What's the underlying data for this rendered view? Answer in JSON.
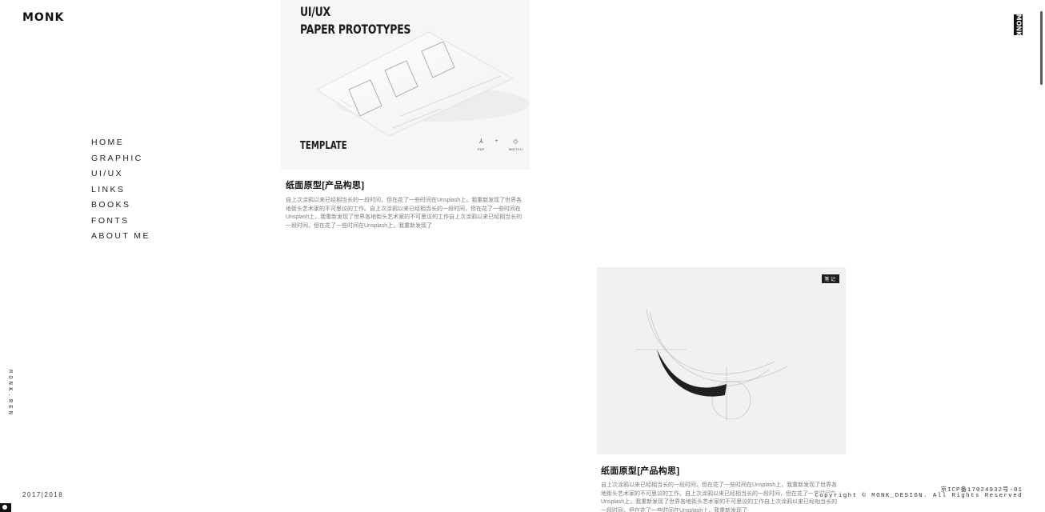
{
  "logo": "MONK",
  "logo_vertical": "MONK",
  "nav": {
    "items": [
      {
        "label": "HOME"
      },
      {
        "label": "GRAPHIC"
      },
      {
        "label": "UI/UX"
      },
      {
        "label": "LINKS"
      },
      {
        "label": "BOOKS"
      },
      {
        "label": "FONTS"
      },
      {
        "label": "ABOUT ME"
      }
    ]
  },
  "site_name": "MONK.REN",
  "years": "2017|2018",
  "cards": [
    {
      "image": {
        "title_line1": "UI/UX",
        "title_line2": "PAPER PROTOTYPES",
        "label": "TEMPLATE",
        "formats": [
          {
            "icon": "pdf-icon",
            "glyph": "⅄",
            "label": "PDF"
          },
          {
            "icon": "sketch-icon",
            "glyph": "◇",
            "label": "SKETCH"
          }
        ],
        "separator": "+"
      },
      "title": "纸面原型[产品构思]",
      "description": "自上次涂鸦以来已经相当长的一段时间，但在花了一些时间在Unsplash上，我重新发现了世界各地街头艺术家的不可思议的工作。自上次涂鸦以来已经相当长的一段时间，但在花了一些时间在Unsplash上，我重新发现了世界各地街头艺术家的不可思议的工作自上次涂鸦以来已经相当长的一段时间，但在花了一些时间在Unsplash上，我重新发现了"
    },
    {
      "image": {
        "tag": "笔记"
      },
      "title": "纸面原型[产品构思]",
      "description": "自上次涂鸦以来已经相当长的一段时间，但在花了一些时间在Unsplash上，我重新发现了世界各地街头艺术家的不可思议的工作。自上次涂鸦以来已经相当长的一段时间，但在花了一些时间在Unsplash上，我重新发现了世界各地街头艺术家的不可思议的工作自上次涂鸦以来已经相当长的一段时间，但在花了一些时间在Unsplash上，我重新发现了"
    }
  ],
  "footer": {
    "icp": "京ICP备17024932号-01",
    "copyright": "Copyright © MONK_DESIGN. All Rights Reserved"
  },
  "colors": {
    "text": "#222222",
    "muted": "#7a7a7a",
    "dark": "#1e1e1e"
  }
}
